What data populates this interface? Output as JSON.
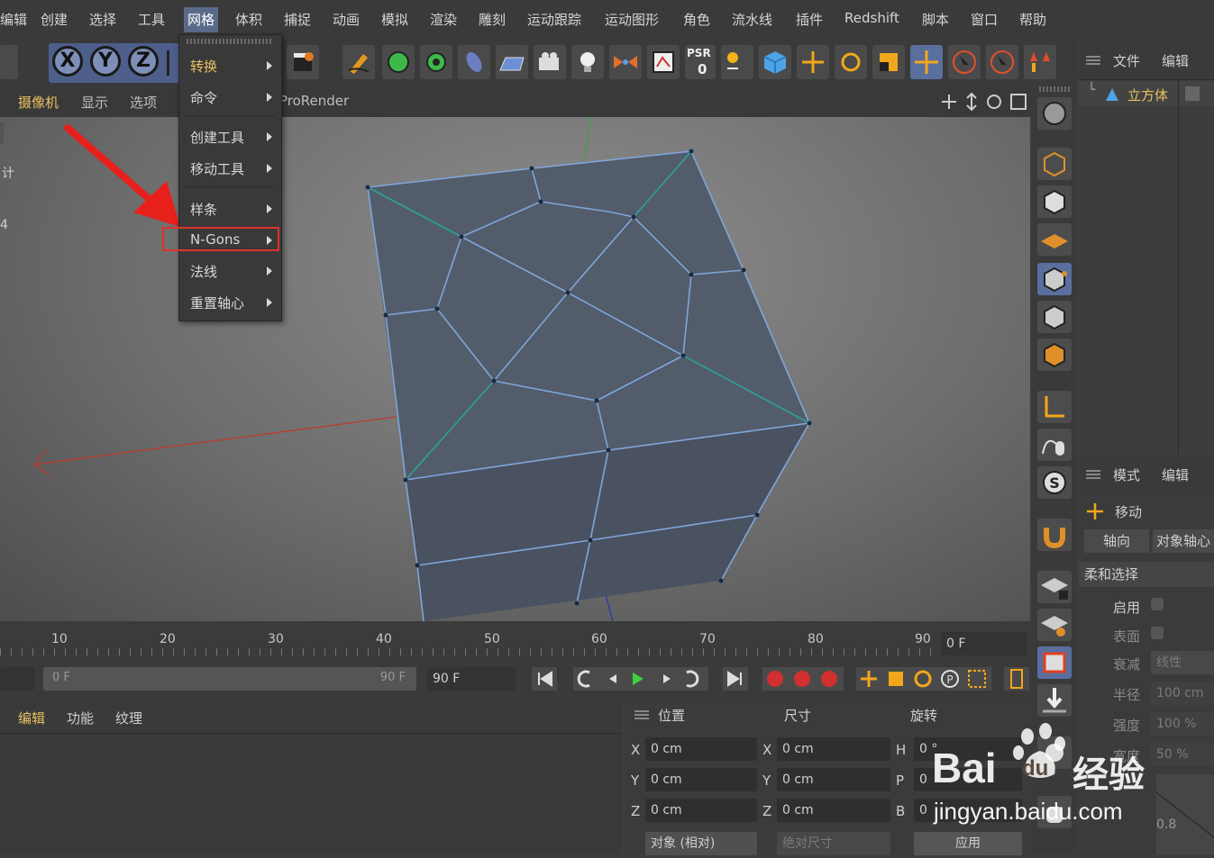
{
  "menubar": {
    "items": [
      "编辑",
      "创建",
      "选择",
      "工具",
      "网格",
      "体积",
      "捕捉",
      "动画",
      "模拟",
      "渲染",
      "雕刻",
      "运动跟踪",
      "运动图形",
      "角色",
      "流水线",
      "插件",
      "Redshift",
      "脚本",
      "窗口",
      "帮助"
    ],
    "active": "网格"
  },
  "toolbar": {
    "axis_x": "X",
    "axis_y": "Y",
    "axis_z": "Z",
    "psr_label": "PSR",
    "psr_value": "0"
  },
  "viewport_menu": {
    "items": [
      "摄像机",
      "显示",
      "选项"
    ],
    "renderer": "ProRender",
    "left_side_text_1": "计",
    "left_side_text_2": "4"
  },
  "dropdown": {
    "items": [
      "转换",
      "命令",
      "创建工具",
      "移动工具",
      "样条",
      "N-Gons",
      "法线",
      "重置轴心"
    ],
    "highlighted": "N-Gons"
  },
  "object_panel": {
    "menu": [
      "文件",
      "编辑"
    ],
    "object_name": "立方体"
  },
  "attribute_panel": {
    "menu": [
      "模式",
      "编辑"
    ],
    "tool_name": "移动",
    "tabs": [
      "轴向",
      "对象轴心"
    ],
    "section": "柔和选择",
    "rows": [
      {
        "label": "启用",
        "value": ""
      },
      {
        "label": "表面",
        "value": ""
      },
      {
        "label": "衰减",
        "value": "线性"
      },
      {
        "label": "半径",
        "value": "100 cm"
      },
      {
        "label": "强度",
        "value": "100 %"
      },
      {
        "label": "宽度",
        "value": "50 %"
      }
    ],
    "graph_label": "0.8"
  },
  "timeline": {
    "ticks": [
      "10",
      "20",
      "30",
      "40",
      "50",
      "60",
      "70",
      "80",
      "90"
    ],
    "current_frame": "0 F"
  },
  "transport": {
    "range_start": "0 F",
    "range_end": "90 F",
    "end_frame": "90 F"
  },
  "bottom_left": {
    "menu": [
      "编辑",
      "功能",
      "纹理"
    ]
  },
  "coords": {
    "headers": [
      "位置",
      "尺寸",
      "旋转"
    ],
    "rows": [
      {
        "axis": "X",
        "pos": "0 cm",
        "saxis": "X",
        "size": "0 cm",
        "raxis": "H",
        "rot": "0 °"
      },
      {
        "axis": "Y",
        "pos": "0 cm",
        "saxis": "Y",
        "size": "0 cm",
        "raxis": "P",
        "rot": "0"
      },
      {
        "axis": "Z",
        "pos": "0 cm",
        "saxis": "Z",
        "size": "0 cm",
        "raxis": "B",
        "rot": "0"
      }
    ],
    "mode_select": "对象 (相对)",
    "size_select": "绝对尺寸",
    "apply": "应用"
  },
  "watermark": {
    "brand": "Bai",
    "brand2": "du",
    "cn": "经验",
    "url": "jingyan.baidu.com"
  }
}
